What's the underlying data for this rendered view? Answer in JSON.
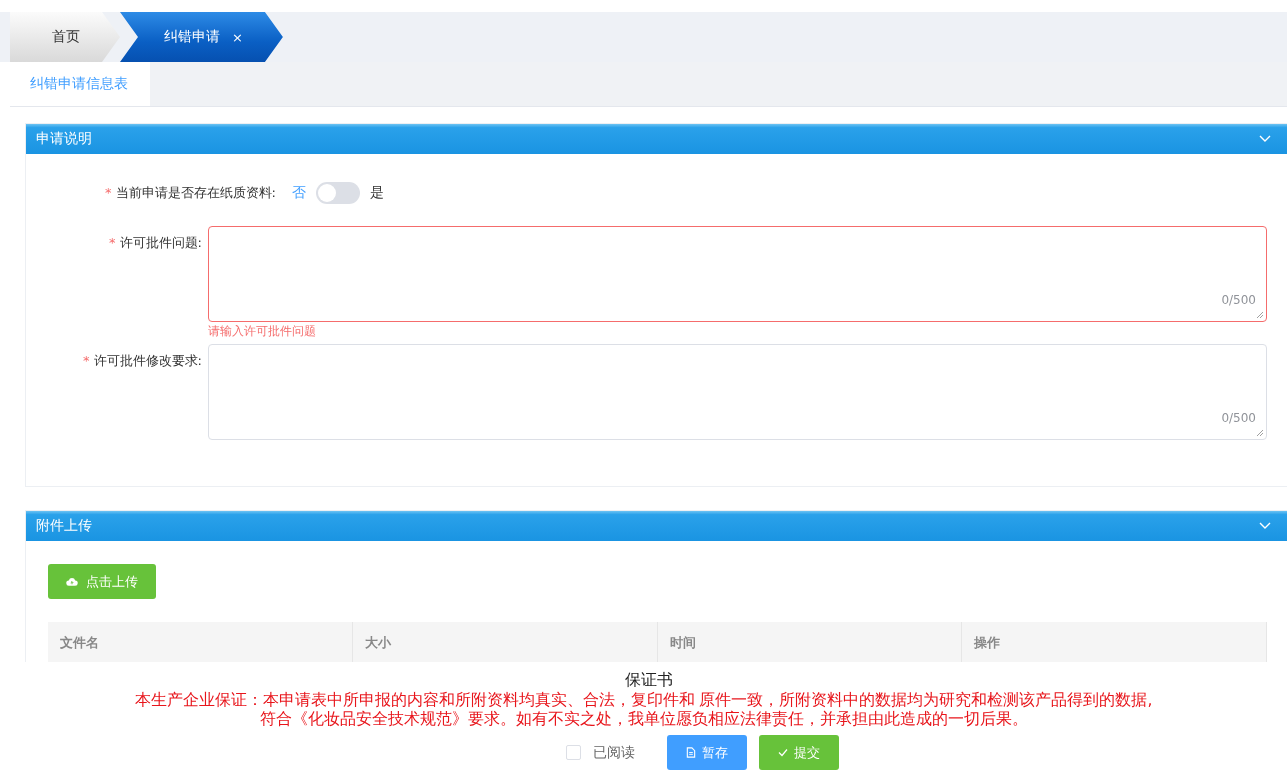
{
  "tabs": [
    {
      "label": "首页",
      "selected": false
    },
    {
      "label": "纠错申请",
      "selected": true,
      "close": "×"
    }
  ],
  "subtabs": [
    {
      "label": "纠错申请信息表",
      "selected": true
    }
  ],
  "sections": [
    {
      "title": "申请说明",
      "expanded": true,
      "fields": [
        {
          "kind": "toggle",
          "label": "当前申请是否存在纸质资料:",
          "mark": "*",
          "off_label": "否",
          "on_label": "是",
          "on": false
        },
        {
          "kind": "textarea",
          "label": "许可批件问题:",
          "mark": "*",
          "counter": "0/500",
          "invalid": true,
          "error": "请输入许可批件问题"
        },
        {
          "kind": "textarea",
          "label": "许可批件修改要求:",
          "mark": "*",
          "counter": "0/500",
          "invalid": false
        }
      ]
    }
  ],
  "upload": {
    "title": "附件上传",
    "expanded": true,
    "button": "点击上传",
    "columns": [
      "文件名",
      "大小",
      "时间",
      "操作"
    ]
  },
  "guarantee": {
    "title": "保证书",
    "lines": [
      "本生产企业保证：本申请表中所申报的内容和所附资料均真实、合法，复印件和 原件一致，所附资料中的数据均为研究和检测该产品得到的数据,",
      "符合《化妆品安全技术规范》要求。如有不实之处，我单位愿负相应法律责任，并承担由此造成的一切后果。"
    ],
    "read": {
      "label": "已阅读",
      "checked": false
    },
    "buttons": [
      {
        "kind": "save",
        "label": "暂存"
      },
      {
        "kind": "submit",
        "label": "提交"
      }
    ]
  }
}
